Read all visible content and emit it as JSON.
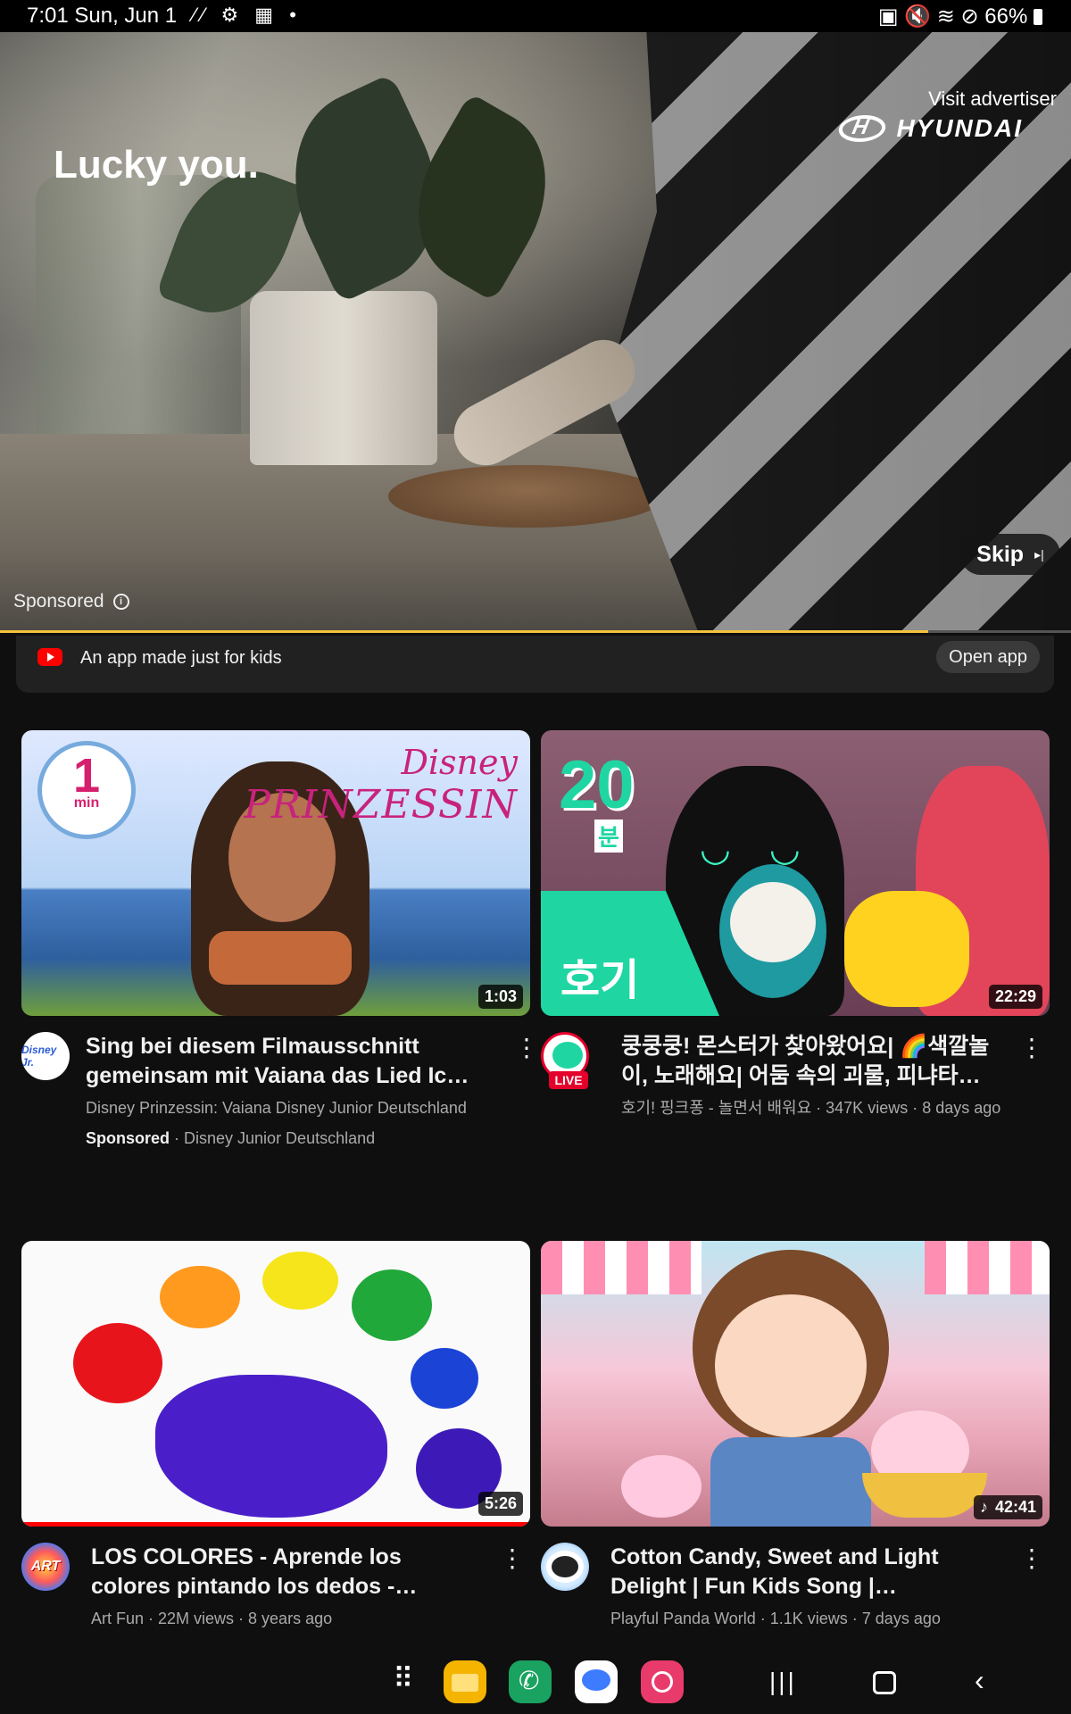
{
  "status_bar": {
    "time_date": "7:01  Sun, Jun 1",
    "left_icons": "⁄⁄ ⚙ ▦ •",
    "battery": "66%",
    "right_icons": "▣ 🔇 ≋ ⊘"
  },
  "ad": {
    "headline": "Lucky you.",
    "visit_advertiser": "Visit advertiser",
    "brand_name": "HYUNDAI",
    "sponsored_label": "Sponsored",
    "info_icon": "i",
    "skip_label": "Skip",
    "skip_icon": "▸|",
    "progress": 0.867
  },
  "promo": {
    "text": "An app made just for kids",
    "button": "Open app"
  },
  "videos": [
    {
      "duration": "1:03",
      "title": "Sing bei diesem Filmausschnitt gemeinsam mit Vaiana das Lied Ich …",
      "meta_line1": "Disney Prinzessin: Vaiana Disney Junior Deutschland",
      "sponsored": "Sponsored",
      "sponsor_channel": " · Disney Junior Deutschland",
      "thumb_logo_big": "1",
      "thumb_logo_small": "min",
      "thumb_disney": "Disney",
      "thumb_prinzessin": "PRINZESSIN",
      "avatar_text": "Disney Jr."
    },
    {
      "duration": "22:29",
      "title": "쿵쿵쿵! 몬스터가 찾아왔어요| 🌈색깔놀이, 노래해요| 어둠 속의 괴물, 피냐타 외…",
      "meta_line1": "호기! 핑크퐁 - 놀면서 배워요 · 347K views · 8 days ago",
      "live_badge": "LIVE",
      "thumb_num": "20",
      "thumb_bun": "분",
      "thumb_hogi": "호기",
      "eyes": "◡ ◡"
    },
    {
      "duration": "5:26",
      "title": "LOS COLORES - Aprende los colores pintando los dedos - Nom…",
      "meta_line1": "Art Fun · 22M views · 8 years ago",
      "avatar_text": "ART",
      "progress": 1.0
    },
    {
      "duration": "42:41",
      "duration_icon": "♪",
      "title": "Cotton Candy, Sweet and Light Delight | Fun Kids Song | Preschoo…",
      "meta_line1": "Playful Panda World · 1.1K views · 7 days ago"
    }
  ],
  "kebab": "⋮",
  "nav": {
    "apps_grid": "⠿",
    "recent": "|||",
    "back": "‹"
  },
  "colors": {
    "background": "#0f0f0f",
    "ad_progress": "#f3c33c",
    "youtube_red": "#ff0000",
    "live_red": "#e4002b"
  }
}
